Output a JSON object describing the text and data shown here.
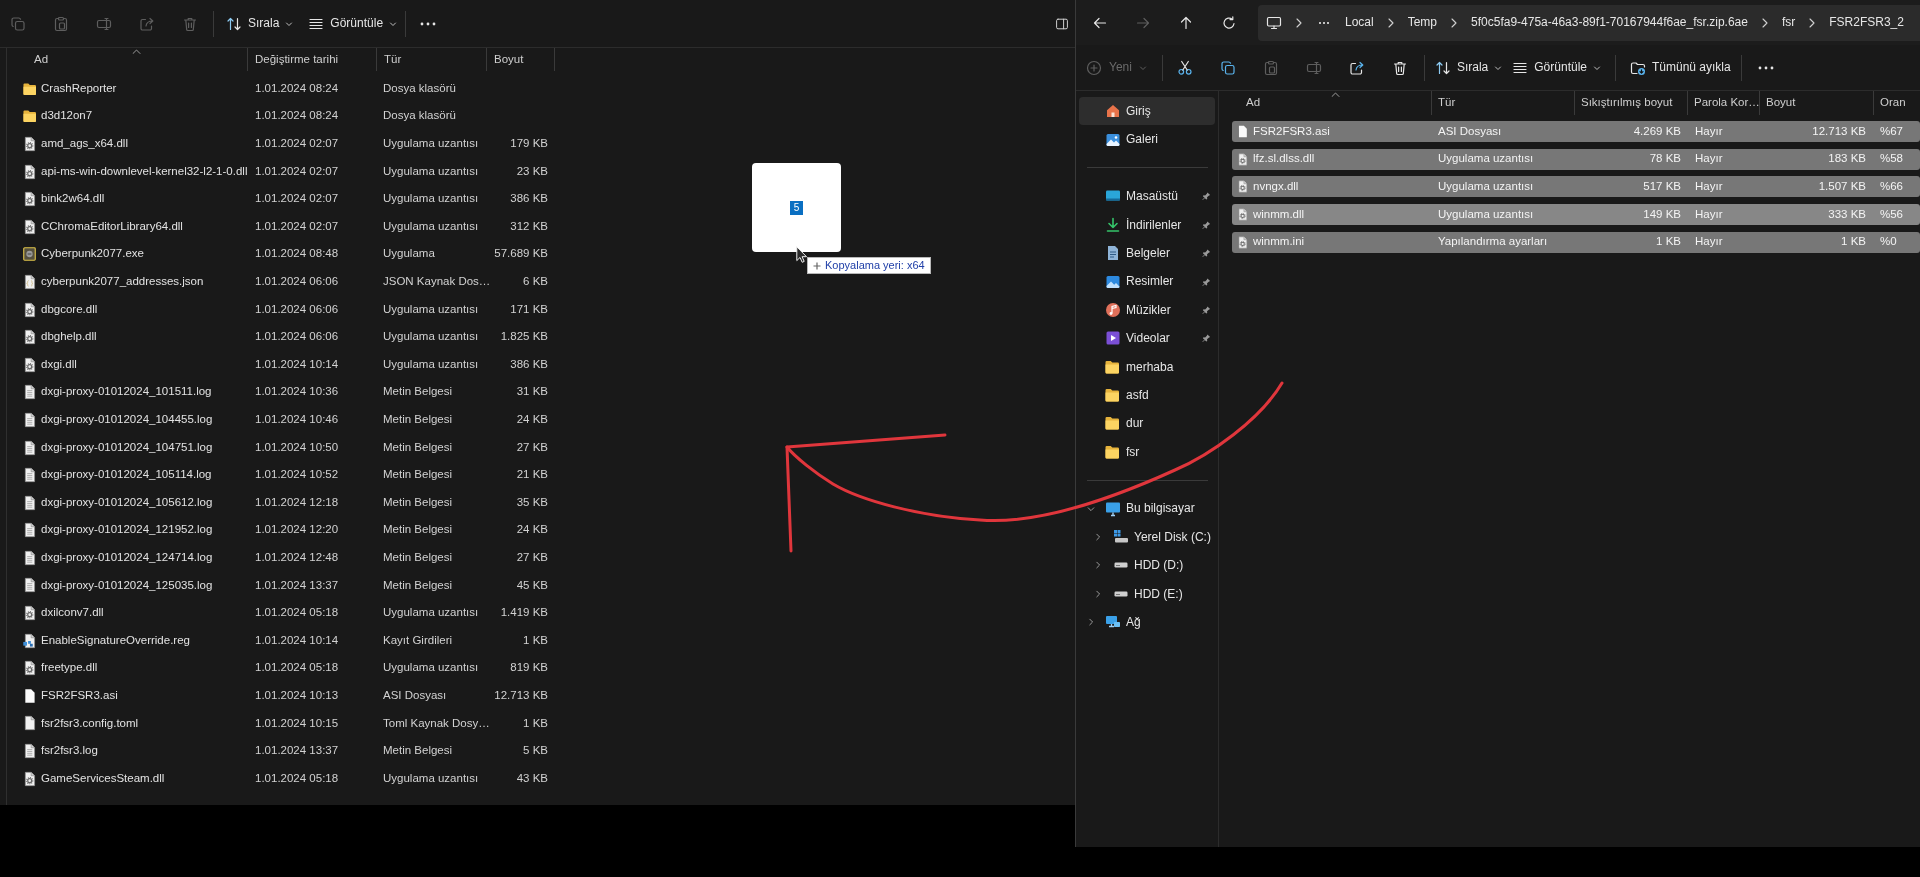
{
  "left_window": {
    "toolbar": {
      "icon_buttons": [
        {
          "kind": "copy",
          "disabled": true
        },
        {
          "kind": "paste",
          "disabled": true
        },
        {
          "kind": "rename",
          "disabled": true
        },
        {
          "kind": "share",
          "disabled": true
        },
        {
          "kind": "delete",
          "disabled": true
        }
      ],
      "sort_button": {
        "label": "Sırala"
      },
      "view_button": {
        "label": "Görüntüle"
      }
    },
    "columns": [
      {
        "label": "Ad",
        "sorted": true
      },
      {
        "label": "Değiştirme tarihi",
        "sorted": false
      },
      {
        "label": "Tür",
        "sorted": false
      },
      {
        "label": "Boyut",
        "sorted": false
      }
    ],
    "rows": [
      {
        "kind": "folder",
        "name": "CrashReporter",
        "modified": "1.01.2024 08:24",
        "type": "Dosya klasörü"
      },
      {
        "kind": "folder",
        "name": "d3d12on7",
        "modified": "1.01.2024 08:24",
        "type": "Dosya klasörü"
      },
      {
        "kind": "dll",
        "name": "amd_ags_x64.dll",
        "modified": "1.01.2024 02:07",
        "type": "Uygulama uzantısı",
        "size": "179 KB"
      },
      {
        "kind": "dll",
        "name": "api-ms-win-downlevel-kernel32-l2-1-0.dll",
        "modified": "1.01.2024 02:07",
        "type": "Uygulama uzantısı",
        "size": "23 KB"
      },
      {
        "kind": "dll",
        "name": "bink2w64.dll",
        "modified": "1.01.2024 02:07",
        "type": "Uygulama uzantısı",
        "size": "386 KB"
      },
      {
        "kind": "dll",
        "name": "CChromaEditorLibrary64.dll",
        "modified": "1.01.2024 02:07",
        "type": "Uygulama uzantısı",
        "size": "312 KB"
      },
      {
        "kind": "exe",
        "name": "Cyberpunk2077.exe",
        "modified": "1.01.2024 08:48",
        "type": "Uygulama",
        "size": "57.689 KB"
      },
      {
        "kind": "json",
        "name": "cyberpunk2077_addresses.json",
        "modified": "1.01.2024 06:06",
        "type": "JSON Kaynak Dos…",
        "size": "6 KB"
      },
      {
        "kind": "dll",
        "name": "dbgcore.dll",
        "modified": "1.01.2024 06:06",
        "type": "Uygulama uzantısı",
        "size": "171 KB"
      },
      {
        "kind": "dll",
        "name": "dbghelp.dll",
        "modified": "1.01.2024 06:06",
        "type": "Uygulama uzantısı",
        "size": "1.825 KB"
      },
      {
        "kind": "dll",
        "name": "dxgi.dll",
        "modified": "1.01.2024 10:14",
        "type": "Uygulama uzantısı",
        "size": "386 KB"
      },
      {
        "kind": "log",
        "name": "dxgi-proxy-01012024_101511.log",
        "modified": "1.01.2024 10:36",
        "type": "Metin Belgesi",
        "size": "31 KB"
      },
      {
        "kind": "log",
        "name": "dxgi-proxy-01012024_104455.log",
        "modified": "1.01.2024 10:46",
        "type": "Metin Belgesi",
        "size": "24 KB"
      },
      {
        "kind": "log",
        "name": "dxgi-proxy-01012024_104751.log",
        "modified": "1.01.2024 10:50",
        "type": "Metin Belgesi",
        "size": "27 KB"
      },
      {
        "kind": "log",
        "name": "dxgi-proxy-01012024_105114.log",
        "modified": "1.01.2024 10:52",
        "type": "Metin Belgesi",
        "size": "21 KB"
      },
      {
        "kind": "log",
        "name": "dxgi-proxy-01012024_105612.log",
        "modified": "1.01.2024 12:18",
        "type": "Metin Belgesi",
        "size": "35 KB"
      },
      {
        "kind": "log",
        "name": "dxgi-proxy-01012024_121952.log",
        "modified": "1.01.2024 12:20",
        "type": "Metin Belgesi",
        "size": "24 KB"
      },
      {
        "kind": "log",
        "name": "dxgi-proxy-01012024_124714.log",
        "modified": "1.01.2024 12:48",
        "type": "Metin Belgesi",
        "size": "27 KB"
      },
      {
        "kind": "log",
        "name": "dxgi-proxy-01012024_125035.log",
        "modified": "1.01.2024 13:37",
        "type": "Metin Belgesi",
        "size": "45 KB"
      },
      {
        "kind": "dll",
        "name": "dxilconv7.dll",
        "modified": "1.01.2024 05:18",
        "type": "Uygulama uzantısı",
        "size": "1.419 KB"
      },
      {
        "kind": "reg",
        "name": "EnableSignatureOverride.reg",
        "modified": "1.01.2024 10:14",
        "type": "Kayıt Girdileri",
        "size": "1 KB"
      },
      {
        "kind": "dll",
        "name": "freetype.dll",
        "modified": "1.01.2024 05:18",
        "type": "Uygulama uzantısı",
        "size": "819 KB"
      },
      {
        "kind": "asi",
        "name": "FSR2FSR3.asi",
        "modified": "1.01.2024 10:13",
        "type": "ASI Dosyası",
        "size": "12.713 KB"
      },
      {
        "kind": "toml",
        "name": "fsr2fsr3.config.toml",
        "modified": "1.01.2024 10:15",
        "type": "Toml Kaynak Dosy…",
        "size": "1 KB"
      },
      {
        "kind": "log",
        "name": "fsr2fsr3.log",
        "modified": "1.01.2024 13:37",
        "type": "Metin Belgesi",
        "size": "5 KB"
      },
      {
        "kind": "dll",
        "name": "GameServicesSteam.dll",
        "modified": "1.01.2024 05:18",
        "type": "Uygulama uzantısı",
        "size": "43 KB"
      }
    ]
  },
  "drag": {
    "count": "5",
    "tooltip": "Kopyalama yeri: x64"
  },
  "right_window": {
    "nav_buttons": [
      {
        "kind": "back",
        "disabled": false
      },
      {
        "kind": "forward",
        "disabled": true
      },
      {
        "kind": "up",
        "disabled": false
      },
      {
        "kind": "refresh",
        "disabled": false
      }
    ],
    "address_bar": {
      "crumbs": [
        "Local",
        "Temp",
        "5f0c5fa9-475a-46a3-89f1-70167944f6ae_fsr.zip.6ae",
        "fsr",
        "FSR2FSR3_2"
      ]
    },
    "command_bar": {
      "new_button": {
        "label": "Yeni",
        "disabled": true
      },
      "icon_buttons": [
        {
          "kind": "cut",
          "disabled": false
        },
        {
          "kind": "copy",
          "disabled": false
        },
        {
          "kind": "paste",
          "disabled": true
        },
        {
          "kind": "rename",
          "disabled": true
        },
        {
          "kind": "share",
          "disabled": false
        },
        {
          "kind": "delete",
          "disabled": false
        }
      ],
      "sort_button": {
        "label": "Sırala"
      },
      "view_button": {
        "label": "Görüntüle"
      },
      "extract_button": {
        "label": "Tümünü ayıkla"
      }
    },
    "sidebar": {
      "quick": [
        {
          "kind": "home",
          "label": "Giriş",
          "selected": true
        },
        {
          "kind": "gallery",
          "label": "Galeri",
          "selected": false
        }
      ],
      "pinned": [
        {
          "kind": "desktop",
          "label": "Masaüstü",
          "pinned": true,
          "selected": false
        },
        {
          "kind": "downloads",
          "label": "İndirilenler",
          "pinned": true,
          "selected": false
        },
        {
          "kind": "documents",
          "label": "Belgeler",
          "pinned": true,
          "selected": false
        },
        {
          "kind": "pictures",
          "label": "Resimler",
          "pinned": true,
          "selected": false
        },
        {
          "kind": "music",
          "label": "Müzikler",
          "pinned": true,
          "selected": false
        },
        {
          "kind": "videos",
          "label": "Videolar",
          "pinned": true,
          "selected": false
        },
        {
          "kind": "folder",
          "label": "merhaba",
          "pinned": false,
          "selected": false
        },
        {
          "kind": "folder",
          "label": "asfd",
          "pinned": false,
          "selected": false
        },
        {
          "kind": "folder",
          "label": "dur",
          "pinned": false,
          "selected": false
        },
        {
          "kind": "folder",
          "label": "fsr",
          "pinned": false,
          "selected": false
        }
      ],
      "tree": [
        {
          "kind": "pc",
          "label": "Bu bilgisayar",
          "expanded": true,
          "selected": false,
          "children": [
            {
              "kind": "sysdisk",
              "label": "Yerel Disk (C:)",
              "expanded": false,
              "selected": false
            },
            {
              "kind": "disk",
              "label": "HDD (D:)",
              "expanded": false,
              "selected": false
            },
            {
              "kind": "disk",
              "label": "HDD (E:)",
              "expanded": false,
              "selected": false
            }
          ]
        },
        {
          "kind": "network",
          "label": "Ağ",
          "expanded": false,
          "selected": false
        }
      ]
    },
    "columns": [
      {
        "label": "Ad",
        "sorted": true
      },
      {
        "label": "Tür",
        "sorted": false
      },
      {
        "label": "Sıkıştırılmış boyut",
        "sorted": false
      },
      {
        "label": "Parola Kor…",
        "sorted": false
      },
      {
        "label": "Boyut",
        "sorted": false
      },
      {
        "label": "Oran",
        "sorted": false
      }
    ],
    "rows": [
      {
        "kind": "asi",
        "name": "FSR2FSR3.asi",
        "type": "ASI Dosyası",
        "compressed_size": "4.269 KB",
        "password": "Hayır",
        "size": "12.713 KB",
        "ratio": "%67",
        "selected": true,
        "hovered": false
      },
      {
        "kind": "dll",
        "name": "lfz.sl.dlss.dll",
        "type": "Uygulama uzantısı",
        "compressed_size": "78 KB",
        "password": "Hayır",
        "size": "183 KB",
        "ratio": "%58",
        "selected": true,
        "hovered": false
      },
      {
        "kind": "dll",
        "name": "nvngx.dll",
        "type": "Uygulama uzantısı",
        "compressed_size": "517 KB",
        "password": "Hayır",
        "size": "1.507 KB",
        "ratio": "%66",
        "selected": true,
        "hovered": false
      },
      {
        "kind": "dll",
        "name": "winmm.dll",
        "type": "Uygulama uzantısı",
        "compressed_size": "149 KB",
        "password": "Hayır",
        "size": "333 KB",
        "ratio": "%56",
        "selected": true,
        "hovered": true
      },
      {
        "kind": "ini",
        "name": "winmm.ini",
        "type": "Yapılandırma ayarları",
        "compressed_size": "1 KB",
        "password": "Hayır",
        "size": "1 KB",
        "ratio": "%0",
        "selected": true,
        "hovered": false
      }
    ]
  }
}
